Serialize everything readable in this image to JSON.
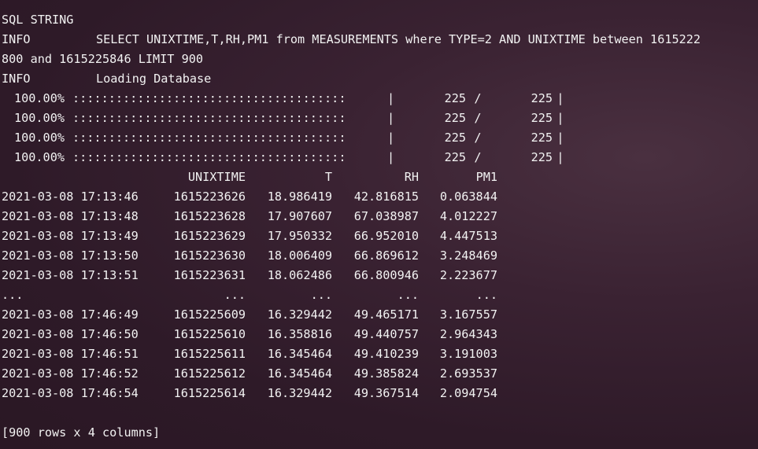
{
  "sql": {
    "header": "SQL STRING",
    "tag": "INFO",
    "query_line1": "SELECT UNIXTIME,T,RH,PM1 from MEASUREMENTS where TYPE=2 AND UNIXTIME between 1615222",
    "query_line2": "800 and 1615225846 LIMIT 900"
  },
  "loading": {
    "tag": "INFO",
    "message": "Loading Database"
  },
  "progress": [
    {
      "percent": "100.00%",
      "bar": "::::::::::::::::::::::::::::::::::::::",
      "sep": "|",
      "current": "225",
      "slash": "/",
      "total": "225",
      "end": "|",
      "fraction": 1.0
    },
    {
      "percent": "100.00%",
      "bar": "::::::::::::::::::::::::::::::::::::::",
      "sep": "|",
      "current": "225",
      "slash": "/",
      "total": "225",
      "end": "|",
      "fraction": 1.0
    },
    {
      "percent": "100.00%",
      "bar": "::::::::::::::::::::::::::::::::::::::",
      "sep": "|",
      "current": "225",
      "slash": "/",
      "total": "225",
      "end": "|",
      "fraction": 1.0
    },
    {
      "percent": "100.00%",
      "bar": "::::::::::::::::::::::::::::::::::::::",
      "sep": "|",
      "current": "225",
      "slash": "/",
      "total": "225",
      "end": "|",
      "fraction": 1.0
    }
  ],
  "table": {
    "columns": [
      "",
      "UNIXTIME",
      "T",
      "RH",
      "PM1"
    ],
    "rows": [
      [
        "2021-03-08 17:13:46",
        "1615223626",
        "18.986419",
        "42.816815",
        "0.063844"
      ],
      [
        "2021-03-08 17:13:48",
        "1615223628",
        "17.907607",
        "67.038987",
        "4.012227"
      ],
      [
        "2021-03-08 17:13:49",
        "1615223629",
        "17.950332",
        "66.952010",
        "4.447513"
      ],
      [
        "2021-03-08 17:13:50",
        "1615223630",
        "18.006409",
        "66.869612",
        "3.248469"
      ],
      [
        "2021-03-08 17:13:51",
        "1615223631",
        "18.062486",
        "66.800946",
        "2.223677"
      ],
      [
        "...",
        "...",
        "...",
        "...",
        "..."
      ],
      [
        "2021-03-08 17:46:49",
        "1615225609",
        "16.329442",
        "49.465171",
        "3.167557"
      ],
      [
        "2021-03-08 17:46:50",
        "1615225610",
        "16.358816",
        "49.440757",
        "2.964343"
      ],
      [
        "2021-03-08 17:46:51",
        "1615225611",
        "16.345464",
        "49.410239",
        "3.191003"
      ],
      [
        "2021-03-08 17:46:52",
        "1615225612",
        "16.345464",
        "49.385824",
        "2.693537"
      ],
      [
        "2021-03-08 17:46:54",
        "1615225614",
        "16.329442",
        "49.367514",
        "2.094754"
      ]
    ],
    "summary": "[900 rows x 4 columns]"
  }
}
